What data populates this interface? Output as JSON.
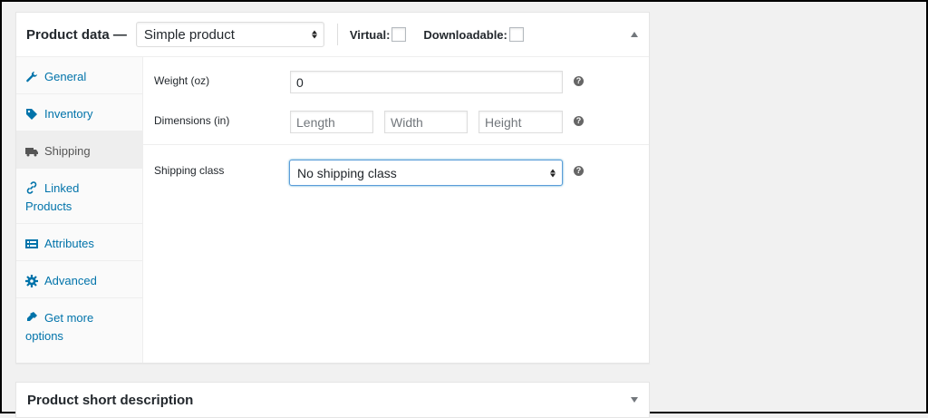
{
  "product_data": {
    "title": "Product data —",
    "product_type": "Simple product",
    "virtual_label": "Virtual:",
    "downloadable_label": "Downloadable:"
  },
  "tabs": [
    {
      "label": "General",
      "icon": "wrench-icon"
    },
    {
      "label": "Inventory",
      "icon": "tag-icon"
    },
    {
      "label": "Shipping",
      "icon": "truck-icon",
      "active": true
    },
    {
      "label_line1": "Linked",
      "label_line2": "Products",
      "icon": "link-icon"
    },
    {
      "label": "Attributes",
      "icon": "list-icon"
    },
    {
      "label": "Advanced",
      "icon": "gear-icon"
    },
    {
      "label_line1": "Get more",
      "label_line2": "options",
      "icon": "plugin-icon"
    }
  ],
  "shipping": {
    "weight_label": "Weight (oz)",
    "weight_value": "0",
    "dimensions_label": "Dimensions (in)",
    "length_placeholder": "Length",
    "width_placeholder": "Width",
    "height_placeholder": "Height",
    "shipping_class_label": "Shipping class",
    "shipping_class_value": "No shipping class",
    "help_glyph": "?"
  },
  "short_description": {
    "title": "Product short description"
  },
  "colors": {
    "link": "#0073aa",
    "focus_border": "#5b9dd9",
    "background": "#f1f1f1"
  }
}
